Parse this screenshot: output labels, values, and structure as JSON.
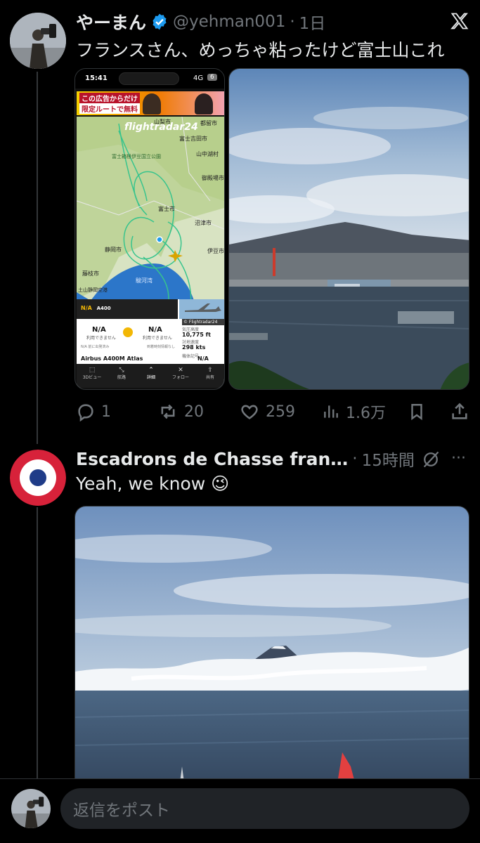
{
  "tweet1": {
    "display_name": "やーまん",
    "handle": "@yehman001",
    "separator": "·",
    "time": "1日",
    "text": "フランスさん、めっちゃ粘ったけど富士山これ",
    "verified": true,
    "verified_color": "#1d9bf0",
    "x_logo_icon": "x-logo-icon",
    "screenshot": {
      "status_time": "15:41",
      "network": "4G",
      "battery": "6",
      "ad_line1": "この広告からだけ",
      "ad_line2": "限定ルートで無料",
      "app_name": "flightradar24",
      "map_labels": [
        "富士市",
        "沼津市",
        "静岡市",
        "藤枝市",
        "伊豆市",
        "御殿場市",
        "山中湖村",
        "富士吉田市",
        "都留市",
        "山梨市",
        "富士箱根伊豆国立公園",
        "駿河湾",
        "土山静岡空港"
      ],
      "flight_code": "N/A",
      "aircraft_code": "A400",
      "from_code": "N/A",
      "from_sub": "利用できません",
      "to_code": "N/A",
      "to_sub": "利用できません",
      "alt_label": "気圧高度",
      "alt_value": "10,775 ft",
      "speed_label": "対地速度",
      "speed_value": "298 kts",
      "reg_label": "機体記号",
      "reg_value": "N/A",
      "photo_credit": "© Flightradar24",
      "aircraft_model": "Airbus A400M Atlas",
      "status_note_left": "N/A 前に出発済み",
      "status_note_right": "到着時刻情報なし",
      "nav": [
        "3Dビュー",
        "航路",
        "詳細",
        "フォロー",
        "共有"
      ]
    },
    "actions": {
      "replies": "1",
      "reposts": "20",
      "likes": "259",
      "views": "1.6万"
    }
  },
  "tweet2": {
    "display_name": "Escadrons de Chasse fran…",
    "separator": "·",
    "time": "15時間",
    "text": "Yeah, we know 😉",
    "more": "···",
    "roundel_colors": {
      "outer": "#d7223a",
      "middle": "#ffffff",
      "inner": "#1f3c88"
    }
  },
  "reply": {
    "placeholder": "返信をポスト"
  }
}
